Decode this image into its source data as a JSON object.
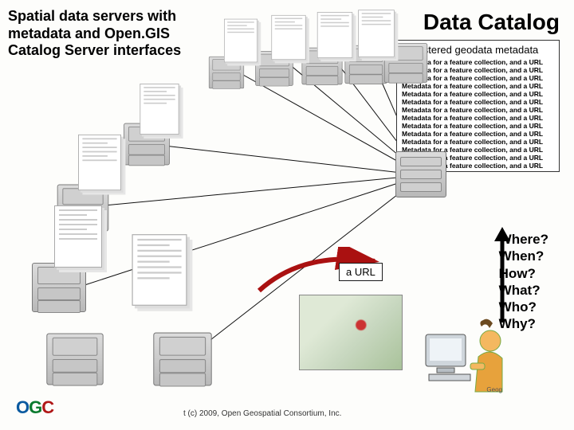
{
  "titles": {
    "left": "Spatial data servers with metadata and Open.GIS Catalog Server interfaces",
    "right": "Data Catalog"
  },
  "catalog": {
    "header": "Registered geodata metadata",
    "entry": "Metadata for a feature collection, and a URL",
    "entryCount": 14
  },
  "urlLabel": "a URL",
  "questions": [
    "Where?",
    "When?",
    "How?",
    "What?",
    "Who?",
    "Why?"
  ],
  "footer": {
    "copyright": "t (c) 2009, Open Geospatial Consortium, Inc.",
    "tiny": "Geog"
  },
  "logo": {
    "o": "O",
    "g": "G",
    "c": "C"
  }
}
